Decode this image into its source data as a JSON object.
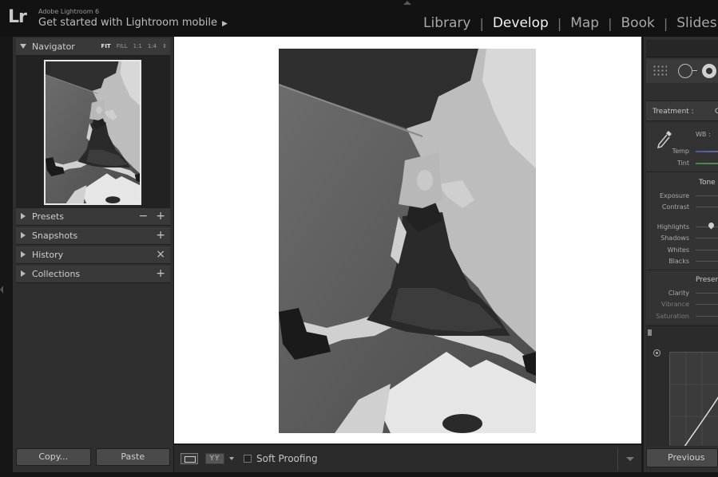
{
  "app": {
    "logo": "Lr",
    "name": "Adobe Lightroom 6",
    "subtitle": "Get started with Lightroom mobile",
    "subtitle_arrow": "▶"
  },
  "modules": [
    {
      "label": "Library",
      "active": false
    },
    {
      "label": "Develop",
      "active": true
    },
    {
      "label": "Map",
      "active": false
    },
    {
      "label": "Book",
      "active": false
    },
    {
      "label": "Slideshow",
      "active": false
    }
  ],
  "module_separator": "|",
  "navigator": {
    "label": "Navigator",
    "zoom": [
      "FIT",
      "FILL",
      "1:1",
      "1:4"
    ],
    "zoom_more": "⇕"
  },
  "left_panels": {
    "presets": {
      "label": "Presets",
      "minus": "−",
      "plus": "+"
    },
    "snapshots": {
      "label": "Snapshots",
      "plus": "+"
    },
    "history": {
      "label": "History",
      "clear": "×"
    },
    "collections": {
      "label": "Collections",
      "plus": "+"
    }
  },
  "buttons": {
    "copy": "Copy...",
    "paste": "Paste",
    "previous": "Previous"
  },
  "toolbar": {
    "yy": "YY",
    "soft_proofing": "Soft Proofing"
  },
  "develop": {
    "treatment_label": "Treatment :",
    "treatment_value": "C",
    "wb_label": "WB :",
    "temp_label": "Temp",
    "tint_label": "Tint",
    "tone_title": "Tone",
    "exposure_label": "Exposure",
    "contrast_label": "Contrast",
    "highlights_label": "Highlights",
    "shadows_label": "Shadows",
    "whites_label": "Whites",
    "blacks_label": "Blacks",
    "presence_title": "Presen",
    "clarity_label": "Clarity",
    "vibrance_label": "Vibrance",
    "saturation_label": "Saturation"
  },
  "colors": {
    "topbar": "#121212",
    "panel": "#2f2f2f",
    "canvas": "#ffffff",
    "active_module": "#f2f2f2",
    "inactive_module": "#a8a8a8"
  },
  "icons": {
    "panel_expanded": "triangle-down-icon",
    "panel_collapsed": "triangle-right-icon",
    "white_balance": "eyedropper-icon",
    "curve_target": "target-adjust-icon"
  }
}
